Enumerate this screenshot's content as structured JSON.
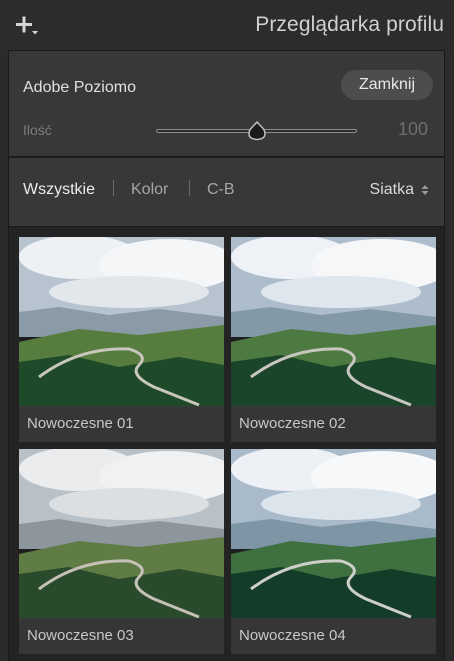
{
  "header": {
    "title": "Przeglądarka profilu",
    "add_icon": "plus-with-dropdown-icon"
  },
  "profile": {
    "name": "Adobe Poziomo",
    "close_label": "Zamknij",
    "amount_label": "Ilość",
    "amount_value": "100",
    "slider_level_percent": 50
  },
  "filters": {
    "items": [
      {
        "label": "Wszystkie",
        "active": true
      },
      {
        "label": "Kolor",
        "active": false
      },
      {
        "label": "C-B",
        "active": false
      }
    ],
    "view_label": "Siatka",
    "view_icon": "up-down-arrows-icon"
  },
  "profiles": [
    {
      "label": "Nowoczesne 01",
      "tone": "neutral"
    },
    {
      "label": "Nowoczesne 02",
      "tone": "cool"
    },
    {
      "label": "Nowoczesne 03",
      "tone": "warm-muted"
    },
    {
      "label": "Nowoczesne 04",
      "tone": "cool-contrast"
    }
  ]
}
